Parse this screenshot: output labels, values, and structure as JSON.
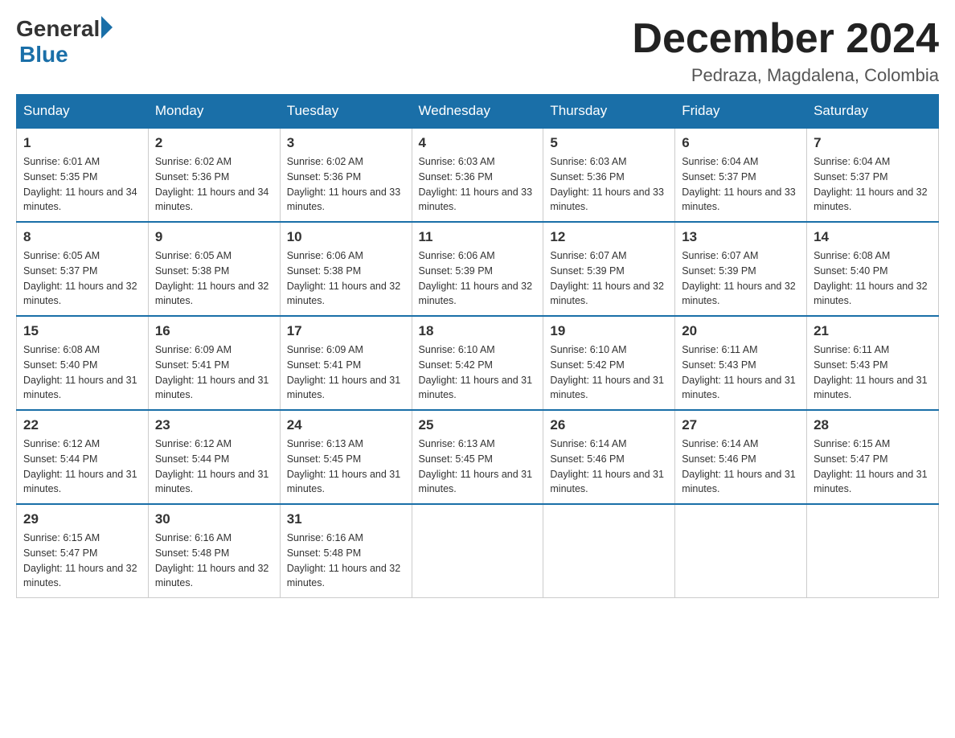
{
  "header": {
    "logo_general": "General",
    "logo_blue": "Blue",
    "month_title": "December 2024",
    "location": "Pedraza, Magdalena, Colombia"
  },
  "days_of_week": [
    "Sunday",
    "Monday",
    "Tuesday",
    "Wednesday",
    "Thursday",
    "Friday",
    "Saturday"
  ],
  "weeks": [
    [
      {
        "day": "1",
        "sunrise": "6:01 AM",
        "sunset": "5:35 PM",
        "daylight": "11 hours and 34 minutes."
      },
      {
        "day": "2",
        "sunrise": "6:02 AM",
        "sunset": "5:36 PM",
        "daylight": "11 hours and 34 minutes."
      },
      {
        "day": "3",
        "sunrise": "6:02 AM",
        "sunset": "5:36 PM",
        "daylight": "11 hours and 33 minutes."
      },
      {
        "day": "4",
        "sunrise": "6:03 AM",
        "sunset": "5:36 PM",
        "daylight": "11 hours and 33 minutes."
      },
      {
        "day": "5",
        "sunrise": "6:03 AM",
        "sunset": "5:36 PM",
        "daylight": "11 hours and 33 minutes."
      },
      {
        "day": "6",
        "sunrise": "6:04 AM",
        "sunset": "5:37 PM",
        "daylight": "11 hours and 33 minutes."
      },
      {
        "day": "7",
        "sunrise": "6:04 AM",
        "sunset": "5:37 PM",
        "daylight": "11 hours and 32 minutes."
      }
    ],
    [
      {
        "day": "8",
        "sunrise": "6:05 AM",
        "sunset": "5:37 PM",
        "daylight": "11 hours and 32 minutes."
      },
      {
        "day": "9",
        "sunrise": "6:05 AM",
        "sunset": "5:38 PM",
        "daylight": "11 hours and 32 minutes."
      },
      {
        "day": "10",
        "sunrise": "6:06 AM",
        "sunset": "5:38 PM",
        "daylight": "11 hours and 32 minutes."
      },
      {
        "day": "11",
        "sunrise": "6:06 AM",
        "sunset": "5:39 PM",
        "daylight": "11 hours and 32 minutes."
      },
      {
        "day": "12",
        "sunrise": "6:07 AM",
        "sunset": "5:39 PM",
        "daylight": "11 hours and 32 minutes."
      },
      {
        "day": "13",
        "sunrise": "6:07 AM",
        "sunset": "5:39 PM",
        "daylight": "11 hours and 32 minutes."
      },
      {
        "day": "14",
        "sunrise": "6:08 AM",
        "sunset": "5:40 PM",
        "daylight": "11 hours and 32 minutes."
      }
    ],
    [
      {
        "day": "15",
        "sunrise": "6:08 AM",
        "sunset": "5:40 PM",
        "daylight": "11 hours and 31 minutes."
      },
      {
        "day": "16",
        "sunrise": "6:09 AM",
        "sunset": "5:41 PM",
        "daylight": "11 hours and 31 minutes."
      },
      {
        "day": "17",
        "sunrise": "6:09 AM",
        "sunset": "5:41 PM",
        "daylight": "11 hours and 31 minutes."
      },
      {
        "day": "18",
        "sunrise": "6:10 AM",
        "sunset": "5:42 PM",
        "daylight": "11 hours and 31 minutes."
      },
      {
        "day": "19",
        "sunrise": "6:10 AM",
        "sunset": "5:42 PM",
        "daylight": "11 hours and 31 minutes."
      },
      {
        "day": "20",
        "sunrise": "6:11 AM",
        "sunset": "5:43 PM",
        "daylight": "11 hours and 31 minutes."
      },
      {
        "day": "21",
        "sunrise": "6:11 AM",
        "sunset": "5:43 PM",
        "daylight": "11 hours and 31 minutes."
      }
    ],
    [
      {
        "day": "22",
        "sunrise": "6:12 AM",
        "sunset": "5:44 PM",
        "daylight": "11 hours and 31 minutes."
      },
      {
        "day": "23",
        "sunrise": "6:12 AM",
        "sunset": "5:44 PM",
        "daylight": "11 hours and 31 minutes."
      },
      {
        "day": "24",
        "sunrise": "6:13 AM",
        "sunset": "5:45 PM",
        "daylight": "11 hours and 31 minutes."
      },
      {
        "day": "25",
        "sunrise": "6:13 AM",
        "sunset": "5:45 PM",
        "daylight": "11 hours and 31 minutes."
      },
      {
        "day": "26",
        "sunrise": "6:14 AM",
        "sunset": "5:46 PM",
        "daylight": "11 hours and 31 minutes."
      },
      {
        "day": "27",
        "sunrise": "6:14 AM",
        "sunset": "5:46 PM",
        "daylight": "11 hours and 31 minutes."
      },
      {
        "day": "28",
        "sunrise": "6:15 AM",
        "sunset": "5:47 PM",
        "daylight": "11 hours and 31 minutes."
      }
    ],
    [
      {
        "day": "29",
        "sunrise": "6:15 AM",
        "sunset": "5:47 PM",
        "daylight": "11 hours and 32 minutes."
      },
      {
        "day": "30",
        "sunrise": "6:16 AM",
        "sunset": "5:48 PM",
        "daylight": "11 hours and 32 minutes."
      },
      {
        "day": "31",
        "sunrise": "6:16 AM",
        "sunset": "5:48 PM",
        "daylight": "11 hours and 32 minutes."
      },
      null,
      null,
      null,
      null
    ]
  ]
}
